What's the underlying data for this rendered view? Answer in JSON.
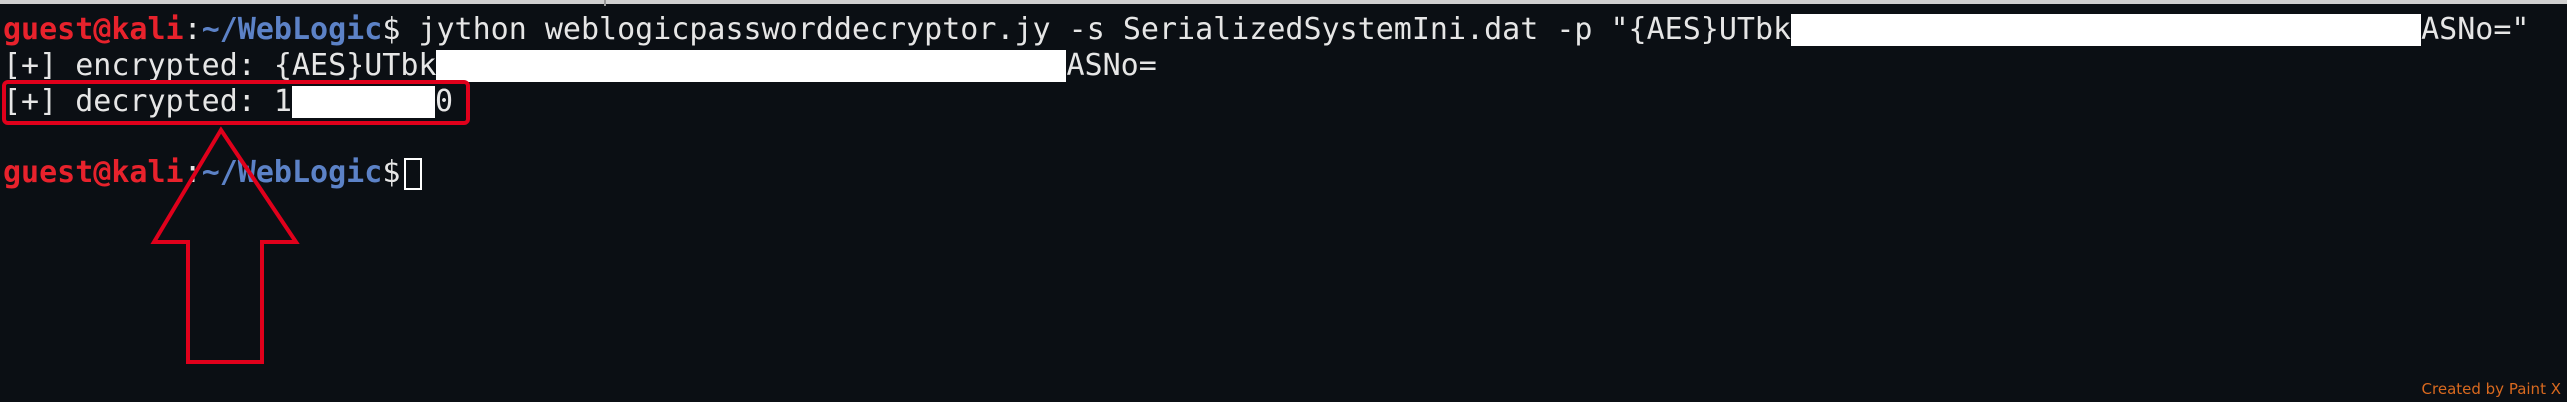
{
  "prompt": {
    "user_host": "guest@kali",
    "colon": ":",
    "path": "~/WebLogic",
    "dollar": "$"
  },
  "lines": {
    "command": " jython weblogicpassworddecryptor.jy -s SerializedSystemIni.dat -p \"{AES}UTbk",
    "command_tail": "ASNo=\"",
    "encrypted_prefix": "[+] encrypted: {AES}UTbk",
    "encrypted_suffix": "ASNo=",
    "decrypted_prefix": "[+] decrypted: 1",
    "decrypted_suffix": "0"
  },
  "annotation": {
    "highlight_color": "#e0001b",
    "arrow_color": "#e0001b"
  },
  "colors": {
    "background": "#0b0f14",
    "text": "#e6e6e6",
    "prompt_user": "#e8222c",
    "prompt_path": "#5c82c7",
    "watermark": "#d9691f"
  },
  "watermark": "Created by Paint X"
}
